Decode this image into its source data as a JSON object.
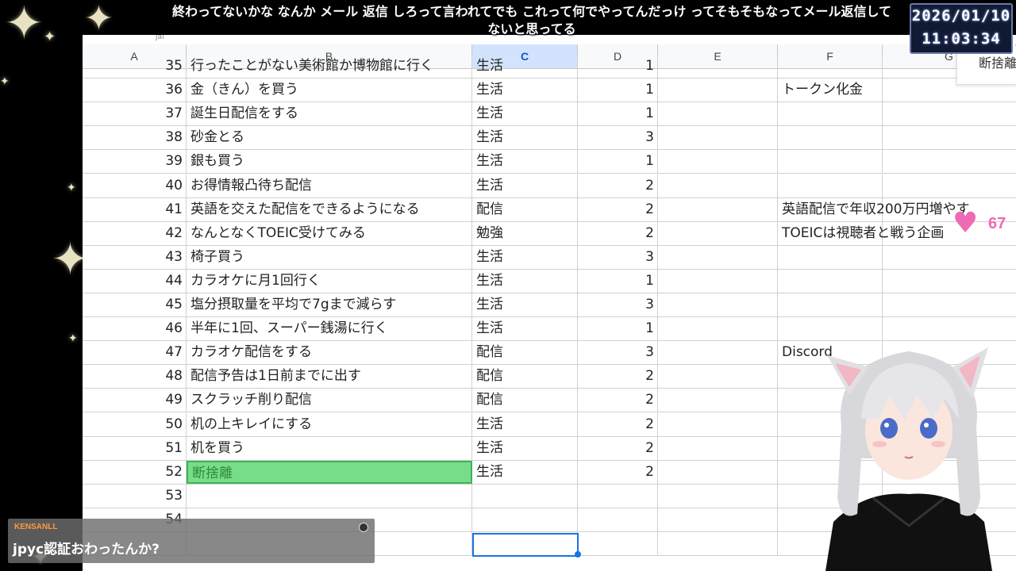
{
  "caption": {
    "line1": "終わってないかな なんか メール 返信 しろって言われてでも これって何でやってんだっけ ってそもそもなってメール返信して",
    "line2": "ないと思ってる"
  },
  "clock": {
    "date": "2026/01/10",
    "time": "11:03:34"
  },
  "sheet": {
    "corner_fragment": "Jal",
    "columns": [
      "A",
      "B",
      "C",
      "D",
      "E",
      "F",
      "G"
    ],
    "selected_column": "C",
    "rows": [
      {
        "n": "35",
        "b": "行ったことがない美術館か博物館に行く",
        "c": "生活",
        "d": "1",
        "f": ""
      },
      {
        "n": "36",
        "b": "金（きん）を買う",
        "c": "生活",
        "d": "1",
        "f": "トークン化金"
      },
      {
        "n": "37",
        "b": "誕生日配信をする",
        "c": "生活",
        "d": "1",
        "f": ""
      },
      {
        "n": "38",
        "b": "砂金とる",
        "c": "生活",
        "d": "3",
        "f": ""
      },
      {
        "n": "39",
        "b": "銀も買う",
        "c": "生活",
        "d": "1",
        "f": ""
      },
      {
        "n": "40",
        "b": "お得情報凸待ち配信",
        "c": "生活",
        "d": "2",
        "f": ""
      },
      {
        "n": "41",
        "b": "英語を交えた配信をできるようになる",
        "c": "配信",
        "d": "2",
        "f": "英語配信で年収200万円増やす"
      },
      {
        "n": "42",
        "b": "なんとなくTOEIC受けてみる",
        "c": "勉強",
        "d": "2",
        "f": "TOEICは視聴者と戦う企画"
      },
      {
        "n": "43",
        "b": "椅子買う",
        "c": "生活",
        "d": "3",
        "f": ""
      },
      {
        "n": "44",
        "b": "カラオケに月1回行く",
        "c": "生活",
        "d": "1",
        "f": ""
      },
      {
        "n": "45",
        "b": "塩分摂取量を平均で7gまで減らす",
        "c": "生活",
        "d": "3",
        "f": ""
      },
      {
        "n": "46",
        "b": "半年に1回、スーパー銭湯に行く",
        "c": "生活",
        "d": "1",
        "f": ""
      },
      {
        "n": "47",
        "b": "カラオケ配信をする",
        "c": "配信",
        "d": "3",
        "f": "Discord"
      },
      {
        "n": "48",
        "b": "配信予告は1日前までに出す",
        "c": "配信",
        "d": "2",
        "f": ""
      },
      {
        "n": "49",
        "b": "スクラッチ削り配信",
        "c": "配信",
        "d": "2",
        "f": ""
      },
      {
        "n": "50",
        "b": "机の上キレイにする",
        "c": "生活",
        "d": "2",
        "f": ""
      },
      {
        "n": "51",
        "b": "机を買う",
        "c": "生活",
        "d": "2",
        "f": ""
      },
      {
        "n": "52",
        "b": "断捨離",
        "c": "生活",
        "d": "2",
        "f": ""
      },
      {
        "n": "53",
        "b": "",
        "c": "",
        "d": "",
        "f": ""
      },
      {
        "n": "54",
        "b": "",
        "c": "",
        "d": "",
        "f": ""
      },
      {
        "n": "",
        "b": "",
        "c": "",
        "d": "",
        "f": ""
      }
    ],
    "side_panel_text": "断捨離"
  },
  "heart": {
    "count": "67",
    "color": "#ee6ab5"
  },
  "chat": {
    "username": "KENSANLL",
    "message": "jpyc認証おわったんか?"
  },
  "colors": {
    "selected_header": "#d3e3fd",
    "selected_cell_fill": "#77dd88",
    "active_border": "#1a73e8"
  }
}
